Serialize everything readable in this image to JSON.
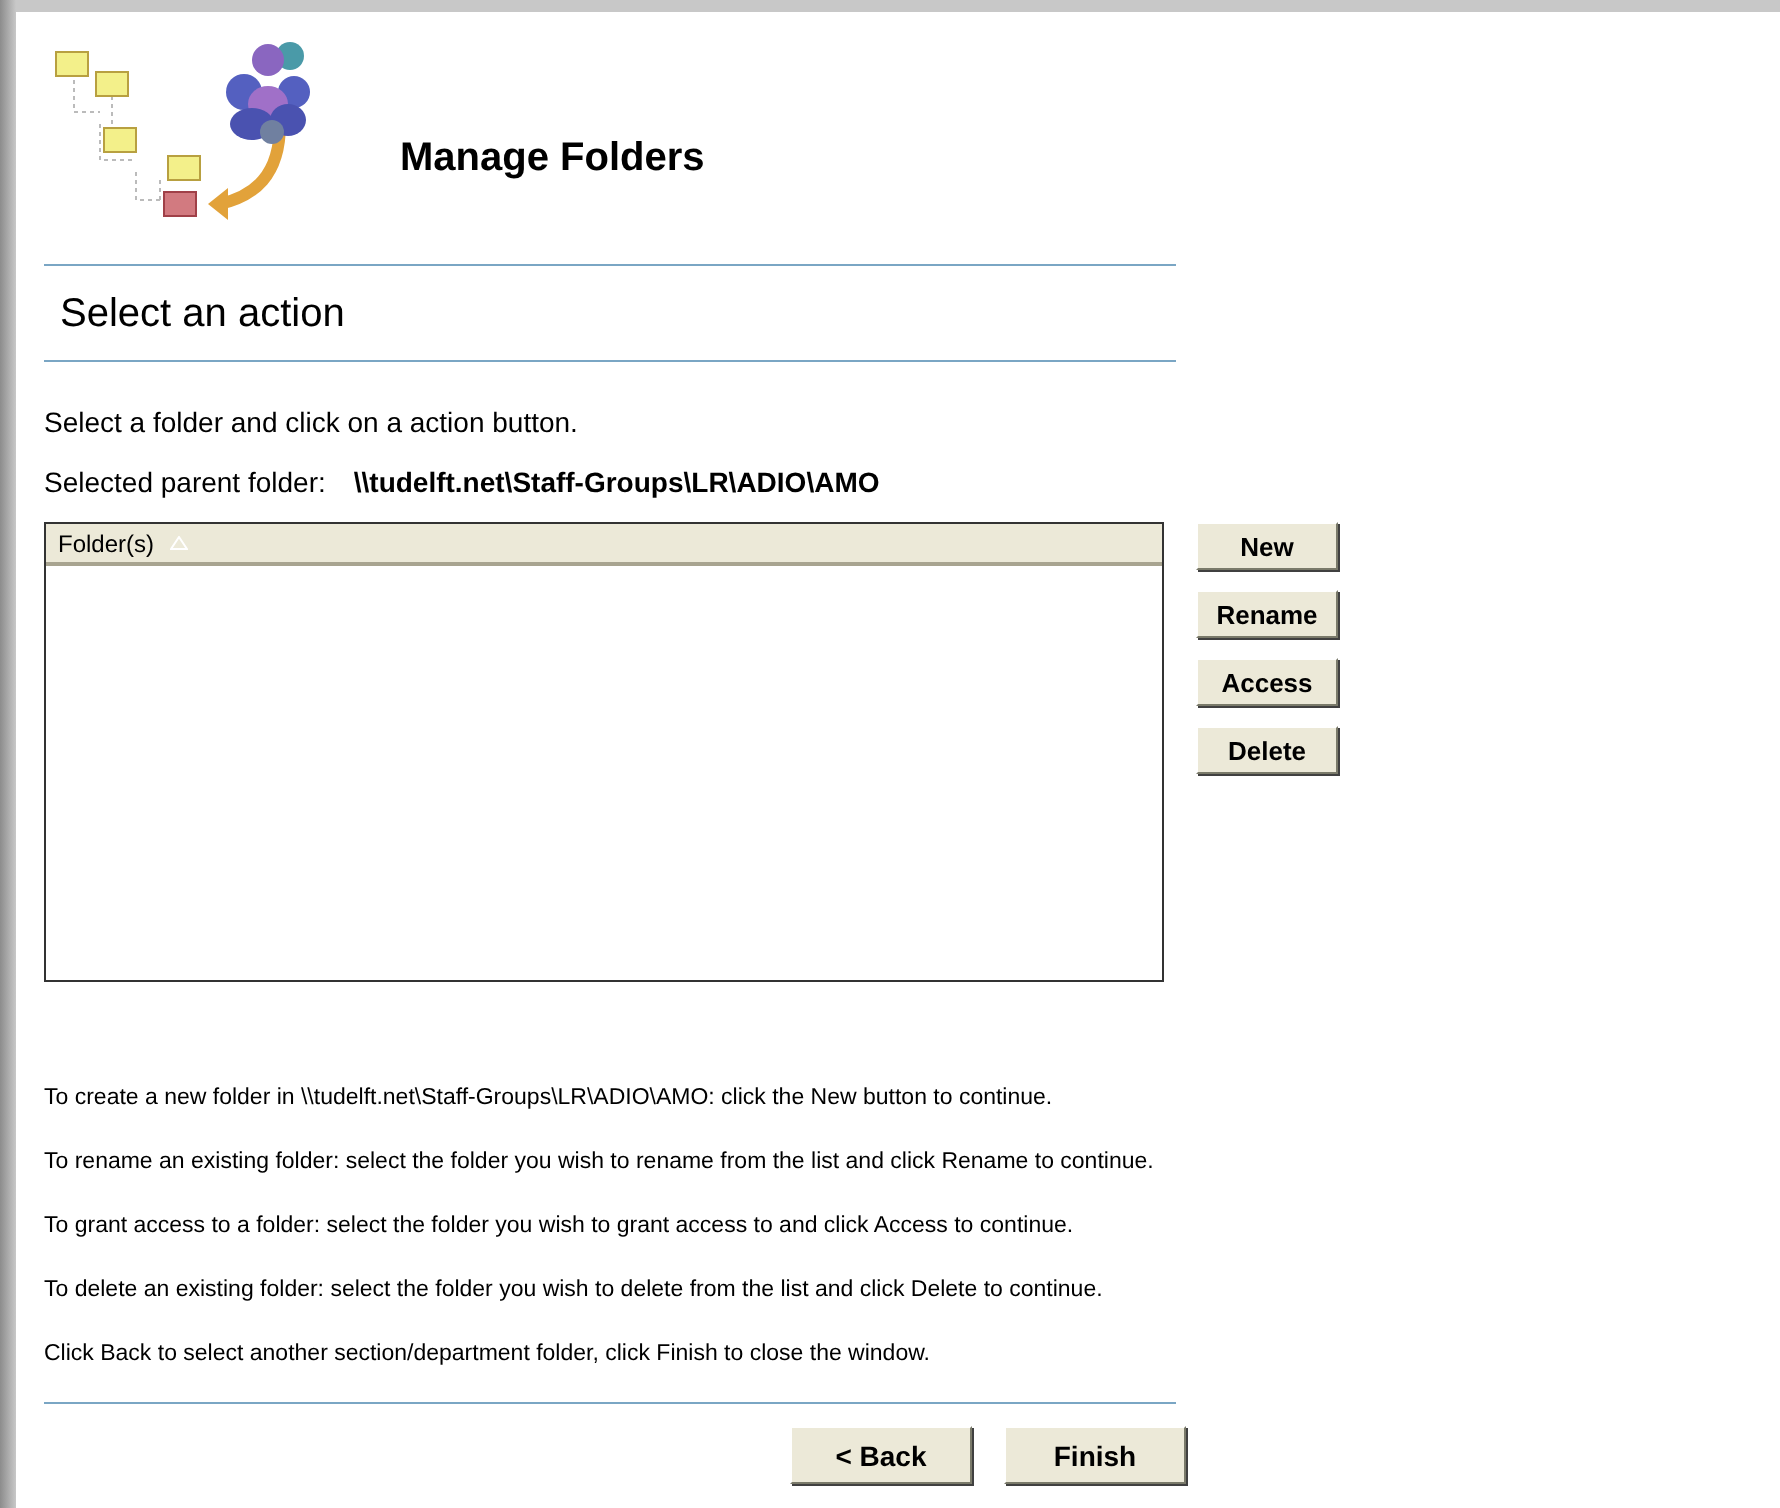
{
  "header": {
    "title": "Manage Folders"
  },
  "section": {
    "title": "Select an action"
  },
  "intro": "Select a folder and click on a action button.",
  "parent_folder": {
    "label": "Selected parent folder:",
    "value": "\\\\tudelft.net\\Staff-Groups\\LR\\ADIO\\AMO"
  },
  "list": {
    "columns": [
      {
        "label": "Folder(s)",
        "sorted_ascending": true
      }
    ]
  },
  "action_buttons": [
    "New",
    "Rename",
    "Access",
    "Delete"
  ],
  "instructions": [
    "To create a new folder in \\\\tudelft.net\\Staff-Groups\\LR\\ADIO\\AMO: click the New button to continue.",
    "To rename an existing folder: select the folder you wish to rename from the list and click Rename to continue.",
    "To grant access to a folder: select the folder you wish to grant access to and click Access to continue.",
    "To delete an existing folder: select the folder you wish to delete from the list and click Delete to continue.",
    "Click Back to select another section/department folder, click Finish to close the window."
  ],
  "footer_buttons": [
    "< Back",
    "Finish"
  ]
}
